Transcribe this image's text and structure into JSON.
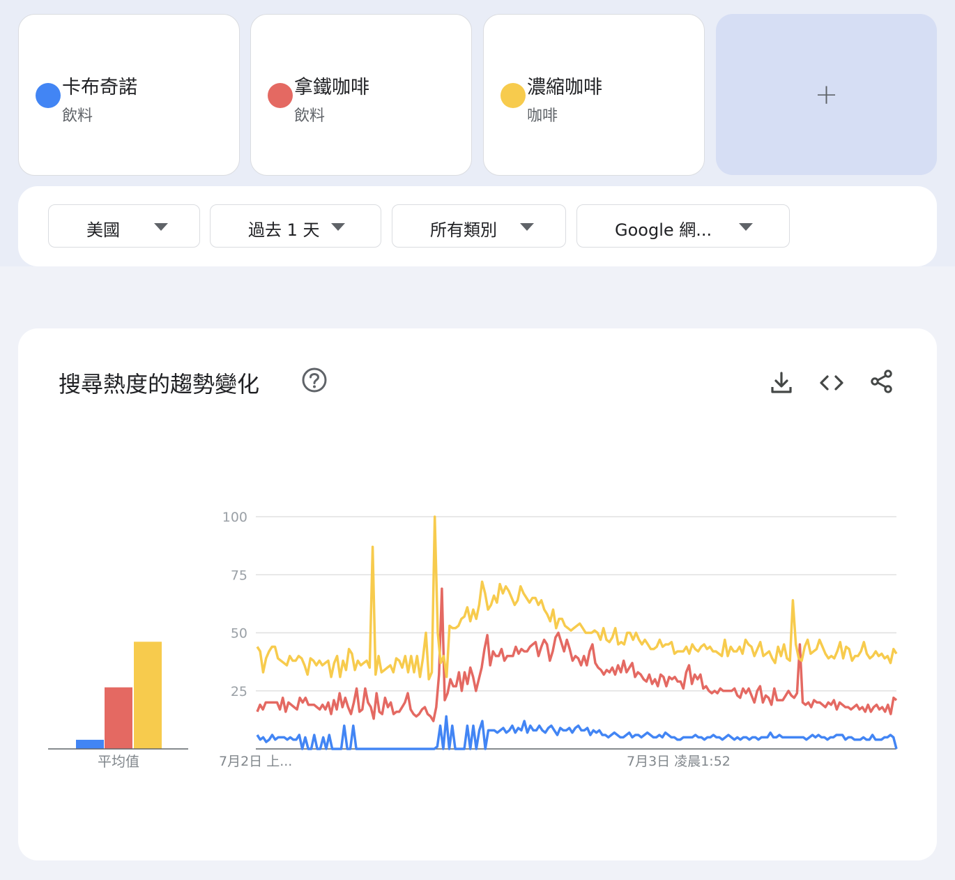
{
  "terms": [
    {
      "name": "卡布奇諾",
      "category": "飲料",
      "color": "#4285f4"
    },
    {
      "name": "拿鐵咖啡",
      "category": "飲料",
      "color": "#e46962"
    },
    {
      "name": "濃縮咖啡",
      "category": "咖啡",
      "color": "#f7cb4d"
    }
  ],
  "add_term": {
    "icon": "plus-icon",
    "label": "+"
  },
  "filters": {
    "region": "美國",
    "time": "過去 1 天",
    "category": "所有類別",
    "property": "Google 網..."
  },
  "panel": {
    "title": "搜尋熱度的趨勢變化",
    "icons": [
      "help-icon",
      "download-icon",
      "embed-code-icon",
      "share-icon"
    ]
  },
  "chart_data": [
    {
      "type": "bar",
      "categories": [
        "卡布奇諾",
        "拿鐵咖啡",
        "濃縮咖啡"
      ],
      "values": [
        4,
        27,
        47
      ],
      "xlabel": "平均值",
      "colors": [
        "#4285f4",
        "#e46962",
        "#f7cb4d"
      ]
    },
    {
      "type": "line",
      "x_tick_labels": [
        "7月2日 上...",
        "7月3日 凌晨1:52"
      ],
      "y_ticks": [
        25,
        50,
        75,
        100
      ],
      "ylim": [
        0,
        100
      ],
      "grid": true,
      "series": [
        {
          "name": "卡布奇諾",
          "color": "#4285f4",
          "values": [
            6,
            4,
            5,
            3,
            4,
            6,
            4,
            5,
            5,
            5,
            4,
            5,
            4,
            4,
            6,
            0,
            5,
            0,
            0,
            6,
            0,
            0,
            5,
            0,
            6,
            0,
            0,
            0,
            0,
            10,
            0,
            0,
            10,
            0,
            0,
            0,
            0,
            0,
            0,
            0,
            0,
            0,
            0,
            0,
            0,
            0,
            0,
            0,
            0,
            0,
            0,
            0,
            0,
            0,
            0,
            0,
            0,
            0,
            0,
            0,
            1,
            10,
            0,
            14,
            0,
            10,
            0,
            0,
            0,
            0,
            10,
            0,
            10,
            0,
            8,
            12,
            0,
            8,
            8,
            8,
            7,
            8,
            9,
            7,
            8,
            10,
            7,
            9,
            8,
            12,
            7,
            10,
            8,
            8,
            10,
            8,
            7,
            9,
            10,
            8,
            6,
            9,
            8,
            8,
            9,
            7,
            9,
            10,
            8,
            8,
            9,
            6,
            8,
            7,
            8,
            6,
            6,
            5,
            6,
            7,
            6,
            5,
            5,
            6,
            7,
            5,
            6,
            6,
            5,
            6,
            7,
            6,
            5,
            5,
            6,
            5,
            7,
            6,
            5,
            5,
            4,
            4,
            5,
            5,
            5,
            5,
            6,
            5,
            5,
            4,
            5,
            5,
            6,
            5,
            5,
            4,
            5,
            6,
            5,
            4,
            5,
            4,
            5,
            5,
            4,
            5,
            5,
            4,
            5,
            5,
            5,
            7,
            5,
            5,
            6,
            5,
            5,
            5,
            5,
            5,
            5,
            5,
            5,
            4,
            5,
            6,
            5,
            6,
            5,
            5,
            4,
            5,
            5,
            6,
            6,
            6,
            4,
            5,
            5,
            4,
            4,
            4,
            5,
            4,
            4,
            6,
            4,
            4,
            4,
            5,
            5,
            6,
            5,
            0
          ]
        },
        {
          "name": "拿鐵咖啡",
          "color": "#e46962",
          "values": [
            16,
            19,
            17,
            20,
            20,
            20,
            20,
            20,
            17,
            22,
            16,
            20,
            19,
            18,
            17,
            22,
            20,
            22,
            19,
            19,
            19,
            18,
            17,
            19,
            17,
            20,
            15,
            21,
            17,
            24,
            18,
            22,
            18,
            15,
            20,
            26,
            16,
            17,
            26,
            20,
            18,
            13,
            24,
            16,
            15,
            22,
            18,
            20,
            15,
            16,
            16,
            18,
            20,
            24,
            17,
            15,
            14,
            15,
            17,
            18,
            15,
            14,
            12,
            18,
            32,
            69,
            21,
            24,
            30,
            27,
            27,
            33,
            25,
            33,
            28,
            35,
            31,
            25,
            30,
            35,
            43,
            49,
            36,
            42,
            40,
            40,
            43,
            38,
            40,
            40,
            40,
            44,
            41,
            43,
            42,
            42,
            44,
            45,
            46,
            40,
            44,
            47,
            45,
            38,
            42,
            48,
            50,
            46,
            42,
            47,
            43,
            38,
            40,
            39,
            36,
            40,
            36,
            42,
            45,
            37,
            35,
            34,
            32,
            34,
            33,
            35,
            32,
            36,
            33,
            38,
            33,
            35,
            37,
            31,
            33,
            32,
            30,
            29,
            32,
            28,
            30,
            27,
            32,
            31,
            27,
            31,
            30,
            31,
            29,
            29,
            26,
            33,
            36,
            28,
            32,
            30,
            32,
            26,
            27,
            25,
            24,
            25,
            24,
            26,
            25,
            25,
            25,
            25,
            26,
            23,
            22,
            26,
            24,
            26,
            23,
            20,
            25,
            27,
            20,
            23,
            22,
            19,
            26,
            21,
            21,
            21,
            23,
            25,
            23,
            22,
            24,
            45,
            20,
            19,
            20,
            18,
            21,
            20,
            20,
            19,
            18,
            20,
            19,
            21,
            17,
            20,
            19,
            18,
            18,
            17,
            18,
            19,
            17,
            18,
            16,
            19,
            16,
            18,
            19,
            17,
            18,
            16,
            19,
            15,
            22,
            21
          ]
        },
        {
          "name": "濃縮咖啡",
          "color": "#f7cb4d",
          "values": [
            44,
            42,
            33,
            39,
            42,
            44,
            44,
            39,
            38,
            37,
            36,
            40,
            38,
            38,
            40,
            39,
            36,
            32,
            39,
            38,
            36,
            38,
            36,
            37,
            38,
            31,
            37,
            40,
            31,
            38,
            34,
            43,
            41,
            34,
            38,
            36,
            37,
            38,
            35,
            87,
            32,
            40,
            33,
            34,
            35,
            36,
            33,
            39,
            38,
            35,
            40,
            33,
            40,
            33,
            40,
            31,
            39,
            50,
            30,
            33,
            100,
            50,
            37,
            40,
            31,
            53,
            52,
            52,
            53,
            56,
            57,
            61,
            55,
            60,
            56,
            62,
            72,
            67,
            60,
            62,
            66,
            63,
            71,
            67,
            70,
            68,
            65,
            62,
            64,
            70,
            67,
            65,
            63,
            65,
            65,
            62,
            64,
            60,
            58,
            55,
            60,
            52,
            56,
            56,
            53,
            52,
            51,
            52,
            53,
            54,
            52,
            50,
            50,
            50,
            51,
            50,
            47,
            52,
            47,
            46,
            48,
            52,
            45,
            46,
            45,
            50,
            50,
            47,
            50,
            47,
            45,
            47,
            45,
            43,
            43,
            44,
            47,
            44,
            45,
            45,
            46,
            41,
            42,
            42,
            42,
            44,
            41,
            45,
            43,
            42,
            44,
            45,
            43,
            44,
            42,
            42,
            41,
            40,
            47,
            40,
            44,
            42,
            42,
            44,
            41,
            47,
            45,
            44,
            40,
            43,
            46,
            40,
            41,
            42,
            39,
            37,
            44,
            40,
            45,
            39,
            38,
            64,
            45,
            39,
            38,
            44,
            47,
            41,
            42,
            43,
            47,
            44,
            41,
            39,
            40,
            39,
            42,
            46,
            39,
            44,
            43,
            38,
            40,
            40,
            42,
            46,
            41,
            39,
            40,
            42,
            40,
            41,
            39,
            40,
            37,
            43,
            41
          ]
        }
      ]
    }
  ]
}
